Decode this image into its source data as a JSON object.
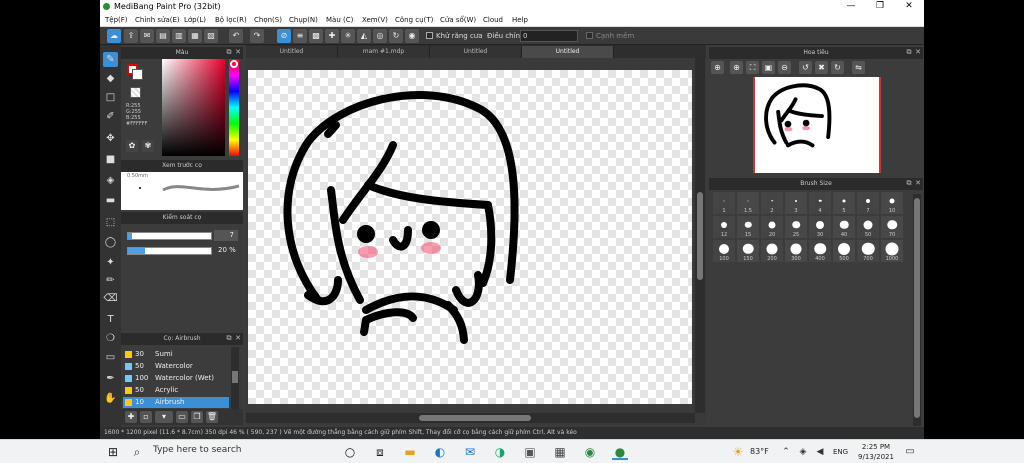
{
  "app": {
    "title": "MediBang Paint Pro (32bit)",
    "minimize": "—",
    "maximize": "❐",
    "close": "✕"
  },
  "menu": [
    "Tệp(F)",
    "Chỉnh sửa(E)",
    "Lớp(L)",
    "Bộ lọc(R)",
    "Chọn(S)",
    "Chụp(N)",
    "Màu (C)",
    "Xem(V)",
    "Công cụ(T)",
    "Cửa sổ(W)",
    "Cloud",
    "Help"
  ],
  "toolbar": {
    "antialias_label": "Khử răng cưa",
    "correction_label": "Điều chỉnh",
    "correction_value": "0",
    "soft_edge_label": "Cạnh mềm"
  },
  "color_panel": {
    "title": "Màu",
    "r": "R:255",
    "g": "G:255",
    "b": "B:255",
    "hex": "#FFFFFF"
  },
  "brush_preview": {
    "title": "Xem trước cọ",
    "size": "0.50mm"
  },
  "brush_control": {
    "title": "Kiểm soát cọ",
    "size_value": "7",
    "opacity_value": "20 %",
    "opacity_fraction": 0.2,
    "size_fraction": 0.05
  },
  "brush_list": {
    "title": "Cọ: Airbrush",
    "items": [
      {
        "size": "30",
        "name": "Sumi",
        "color": "#f5d000"
      },
      {
        "size": "50",
        "name": "Watercolor",
        "color": "#f5d000"
      },
      {
        "size": "100",
        "name": "Watercolor (Wet)",
        "color": "#f5d000"
      },
      {
        "size": "50",
        "name": "Acrylic",
        "color": "#f5d000"
      },
      {
        "size": "10",
        "name": "Airbrush",
        "color": "#f5d000",
        "selected": true
      }
    ]
  },
  "tabs": [
    "Untitled",
    "mam #1.mdp",
    "Untitled",
    "Untitled"
  ],
  "navigator": {
    "title": "Hoa tiêu"
  },
  "brush_size": {
    "title": "Brush Size",
    "rows": [
      [
        "1",
        "1.5",
        "2",
        "3",
        "4",
        "5",
        "7",
        "10"
      ],
      [
        "12",
        "15",
        "20",
        "25",
        "30",
        "40",
        "50",
        "70"
      ],
      [
        "100",
        "150",
        "200",
        "300",
        "400",
        "500",
        "700",
        "1000"
      ]
    ]
  },
  "status": "1600 * 1200 pixel   (11.6 * 8.7cm)   350 dpi   46 %   ( 590, 237 )   Vẽ một đường thẳng bằng cách giữ phím Shift, Thay đổi cỡ cọ bằng cách giữ phím Ctrl, Alt và kéo",
  "taskbar": {
    "search_placeholder": "Type here to search",
    "weather": "83°F",
    "lang": "ENG",
    "time": "2:25 PM",
    "date": "9/13/2021"
  },
  "colors": {
    "accent": "#3b8fd4",
    "panel": "#3c3c3c",
    "header": "#2b2b2b"
  }
}
